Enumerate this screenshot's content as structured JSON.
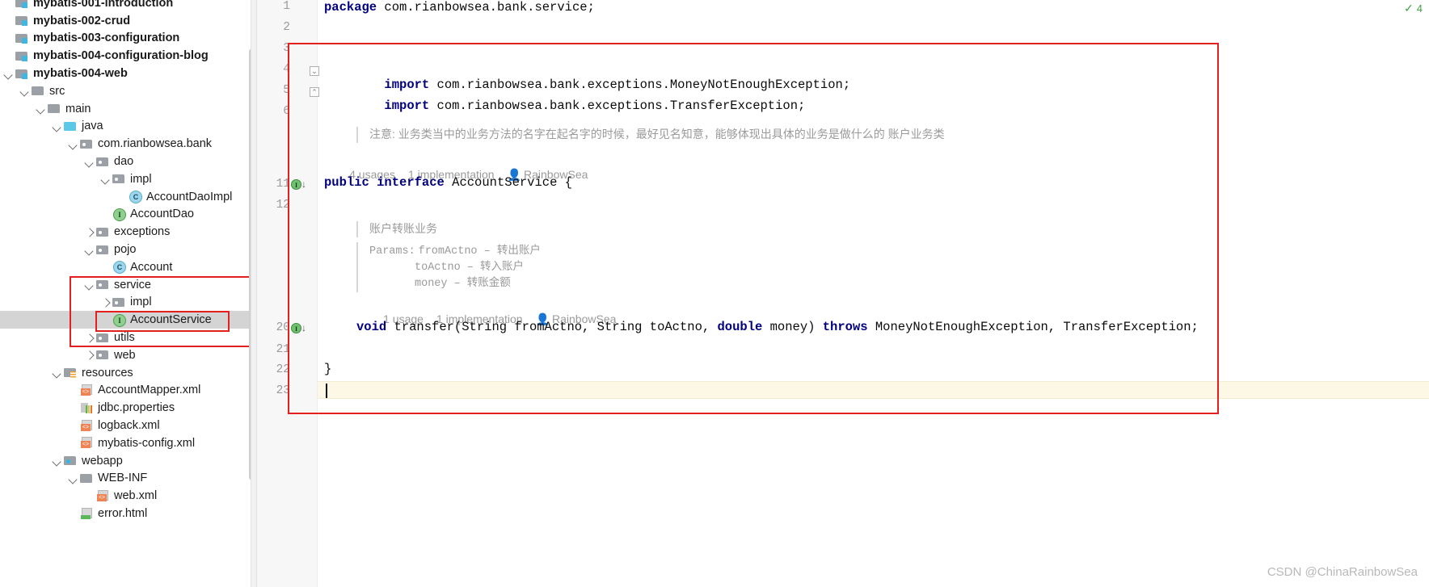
{
  "project_tree": {
    "items": [
      {
        "label": "mybatis-001-introduction",
        "indent": 0,
        "arrow": "none",
        "icon": "module-folder-icon",
        "bold": true,
        "selected": false,
        "partial": true
      },
      {
        "label": "mybatis-002-crud",
        "indent": 0,
        "arrow": "none",
        "icon": "module-folder-icon",
        "bold": true,
        "selected": false
      },
      {
        "label": "mybatis-003-configuration",
        "indent": 0,
        "arrow": "none",
        "icon": "module-folder-icon",
        "bold": true,
        "selected": false
      },
      {
        "label": "mybatis-004-configuration-blog",
        "indent": 0,
        "arrow": "none",
        "icon": "module-folder-icon",
        "bold": true,
        "selected": false
      },
      {
        "label": "mybatis-004-web",
        "indent": 0,
        "arrow": "down",
        "icon": "module-folder-icon",
        "bold": true,
        "selected": false
      },
      {
        "label": "src",
        "indent": 1,
        "arrow": "down",
        "icon": "folder-icon",
        "bold": false,
        "selected": false
      },
      {
        "label": "main",
        "indent": 2,
        "arrow": "down",
        "icon": "folder-icon",
        "bold": false,
        "selected": false
      },
      {
        "label": "java",
        "indent": 3,
        "arrow": "down",
        "icon": "source-folder-icon",
        "bold": false,
        "selected": false
      },
      {
        "label": "com.rianbowsea.bank",
        "indent": 4,
        "arrow": "down",
        "icon": "package-icon",
        "bold": false,
        "selected": false
      },
      {
        "label": "dao",
        "indent": 5,
        "arrow": "down",
        "icon": "package-icon",
        "bold": false,
        "selected": false
      },
      {
        "label": "impl",
        "indent": 6,
        "arrow": "down",
        "icon": "package-icon",
        "bold": false,
        "selected": false
      },
      {
        "label": "AccountDaoImpl",
        "indent": 7,
        "arrow": "none",
        "icon": "java-class-icon",
        "bold": false,
        "selected": false
      },
      {
        "label": "AccountDao",
        "indent": 6,
        "arrow": "none",
        "icon": "java-interface-icon",
        "bold": false,
        "selected": false
      },
      {
        "label": "exceptions",
        "indent": 5,
        "arrow": "right",
        "icon": "package-icon",
        "bold": false,
        "selected": false
      },
      {
        "label": "pojo",
        "indent": 5,
        "arrow": "down",
        "icon": "package-icon",
        "bold": false,
        "selected": false
      },
      {
        "label": "Account",
        "indent": 6,
        "arrow": "none",
        "icon": "java-class-icon",
        "bold": false,
        "selected": false
      },
      {
        "label": "service",
        "indent": 5,
        "arrow": "down",
        "icon": "package-icon",
        "bold": false,
        "selected": false
      },
      {
        "label": "impl",
        "indent": 6,
        "arrow": "right",
        "icon": "package-icon",
        "bold": false,
        "selected": false
      },
      {
        "label": "AccountService",
        "indent": 6,
        "arrow": "none",
        "icon": "java-interface-icon",
        "bold": false,
        "selected": true
      },
      {
        "label": "utils",
        "indent": 5,
        "arrow": "right",
        "icon": "package-icon",
        "bold": false,
        "selected": false
      },
      {
        "label": "web",
        "indent": 5,
        "arrow": "right",
        "icon": "package-icon",
        "bold": false,
        "selected": false
      },
      {
        "label": "resources",
        "indent": 3,
        "arrow": "down",
        "icon": "resources-folder-icon",
        "bold": false,
        "selected": false
      },
      {
        "label": "AccountMapper.xml",
        "indent": 4,
        "arrow": "none",
        "icon": "xml-file-icon",
        "bold": false,
        "selected": false
      },
      {
        "label": "jdbc.properties",
        "indent": 4,
        "arrow": "none",
        "icon": "properties-file-icon",
        "bold": false,
        "selected": false
      },
      {
        "label": "logback.xml",
        "indent": 4,
        "arrow": "none",
        "icon": "xml-file-icon",
        "bold": false,
        "selected": false
      },
      {
        "label": "mybatis-config.xml",
        "indent": 4,
        "arrow": "none",
        "icon": "xml-file-icon",
        "bold": false,
        "selected": false
      },
      {
        "label": "webapp",
        "indent": 3,
        "arrow": "down",
        "icon": "webapp-folder-icon",
        "bold": false,
        "selected": false
      },
      {
        "label": "WEB-INF",
        "indent": 4,
        "arrow": "down",
        "icon": "folder-icon",
        "bold": false,
        "selected": false
      },
      {
        "label": "web.xml",
        "indent": 5,
        "arrow": "none",
        "icon": "xml-file-icon",
        "bold": false,
        "selected": false
      },
      {
        "label": "error.html",
        "indent": 4,
        "arrow": "none",
        "icon": "html-file-icon",
        "bold": false,
        "selected": false
      }
    ]
  },
  "editor": {
    "line_numbers": [
      "1",
      "2",
      "3",
      "4",
      "5",
      "6",
      "11",
      "12",
      "20",
      "21",
      "22",
      "23"
    ],
    "code": {
      "l1_kw": "package",
      "l1_rest": " com.rianbowsea.bank.service;",
      "l4_kw": "import",
      "l4_rest": " com.rianbowsea.bank.exceptions.MoneyNotEnoughException;",
      "l5_kw": "import",
      "l5_rest": " com.rianbowsea.bank.exceptions.TransferException;",
      "l11_kw1": "public",
      "l11_kw2": "interface",
      "l11_name": "AccountService",
      "l11_brace": "{",
      "l20_kw1": "void",
      "l20_sig_a": " transfer(String fromActno, String toActno, ",
      "l20_kw2": "double",
      "l20_sig_b": " money)",
      "l20_kw3": "throws",
      "l20_sig_c": " MoneyNotEnoughException, TransferException;",
      "l22_brace": "}"
    },
    "class_comment": "注意: 业务类当中的业务方法的名字在起名字的时候，最好见名知意，能够体现出具体的业务是做什么的 账户业务类",
    "class_hints": {
      "usages": "4 usages",
      "implementations": "1 implementation",
      "author": "RainbowSea"
    },
    "method_doc": {
      "summary": "账户转账业务",
      "params_label": "Params:",
      "params": [
        "fromActno – 转出账户",
        "toActno – 转入账户",
        "money – 转账金额"
      ]
    },
    "method_hints": {
      "usages": "1 usage",
      "implementations": "1 implementation",
      "author": "RainbowSea"
    },
    "gutter_badge_label": "I",
    "gutter_badge_arrow": "↓",
    "inspection_status": "✓",
    "inspection_count": "4"
  },
  "watermark": "CSDN @ChinaRainbowSea",
  "colors": {
    "keyword": "#000080",
    "annotation_red": "#e41f1f",
    "selection_grey": "#d4d4d4",
    "hint_grey": "#9a9a9a",
    "caret_line": "#fdf8e6",
    "ok_green": "#3ea33e"
  }
}
